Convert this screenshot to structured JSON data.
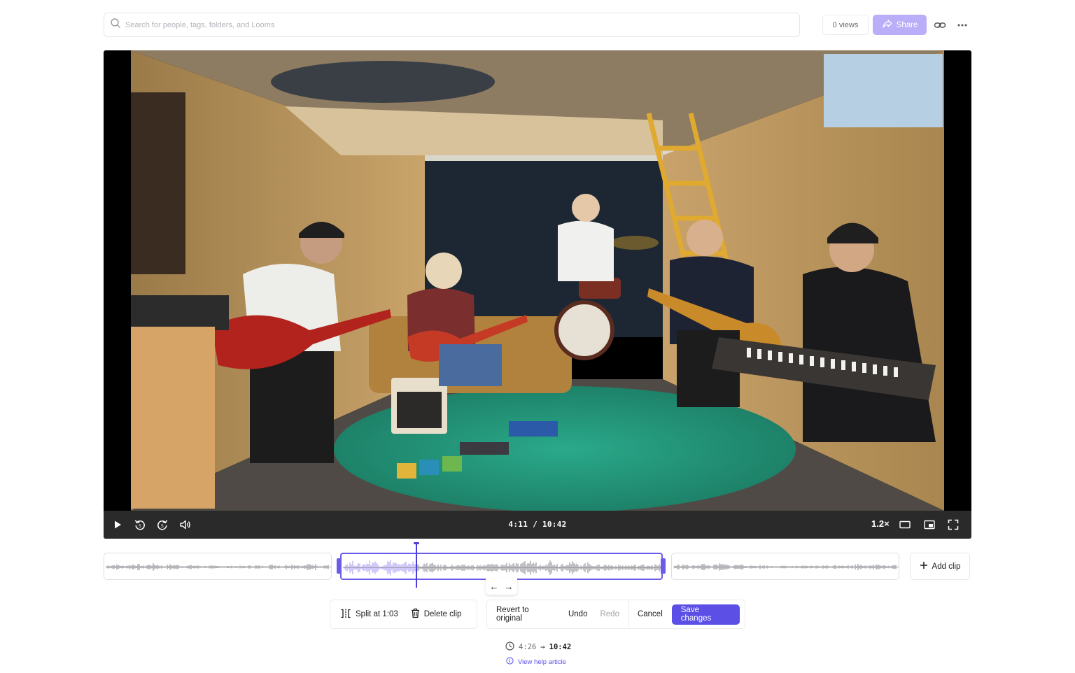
{
  "search": {
    "placeholder": "Search for people, tags, folders, and Looms"
  },
  "header": {
    "views_label": "0 views",
    "share_label": "Share"
  },
  "player": {
    "current_time": "4:11",
    "separator": "/",
    "total_time": "10:42",
    "speed": "1.2×"
  },
  "timeline": {
    "add_clip_label": "Add clip"
  },
  "edit_toolbar": {
    "split_label": "Split at 1:03",
    "delete_label": "Delete clip"
  },
  "history_toolbar": {
    "revert_label": "Revert to original",
    "undo_label": "Undo",
    "redo_label": "Redo",
    "cancel_label": "Cancel",
    "save_label": "Save changes"
  },
  "summary": {
    "original_duration": "4:26",
    "arrow": "→",
    "new_duration": "10:42",
    "help_link": "View help article"
  },
  "colors": {
    "accent": "#5b4fe6",
    "accent_light": "#b9aef7",
    "waveform": "#8e8e94",
    "waveform_selected": "#a99af2"
  }
}
